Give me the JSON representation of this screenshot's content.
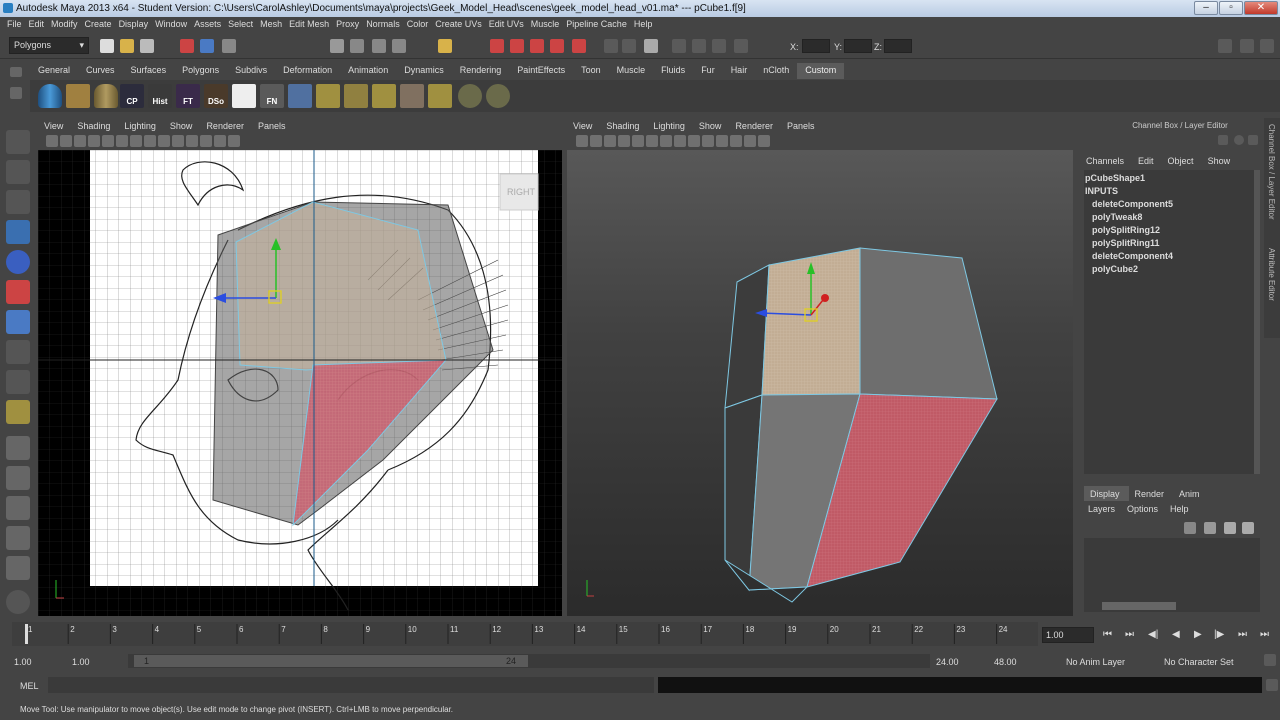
{
  "window": {
    "title": "Autodesk Maya 2013 x64 - Student Version: C:\\Users\\CarolAshley\\Documents\\maya\\projects\\Geek_Model_Head\\scenes\\geek_model_head_v01.ma*   ---   pCube1.f[9]"
  },
  "menu": [
    "File",
    "Edit",
    "Modify",
    "Create",
    "Display",
    "Window",
    "Assets",
    "Select",
    "Mesh",
    "Edit Mesh",
    "Proxy",
    "Normals",
    "Color",
    "Create UVs",
    "Edit UVs",
    "Muscle",
    "Pipeline Cache",
    "Help"
  ],
  "status": {
    "menuset": "Polygons",
    "x_label": "X:",
    "y_label": "Y:",
    "z_label": "Z:"
  },
  "shelf": {
    "tabs": [
      "General",
      "Curves",
      "Surfaces",
      "Polygons",
      "Subdivs",
      "Deformation",
      "Animation",
      "Dynamics",
      "Rendering",
      "PaintEffects",
      "Toon",
      "Muscle",
      "Fluids",
      "Fur",
      "Hair",
      "nCloth",
      "Custom"
    ],
    "active": "Custom",
    "buttons": [
      "",
      "",
      "",
      "CP",
      "Hist",
      "FT",
      "DSo",
      "Outl",
      "FN",
      "",
      "",
      "",
      "",
      "",
      "",
      "",
      ""
    ]
  },
  "viewport_menu": [
    "View",
    "Shading",
    "Lighting",
    "Show",
    "Renderer",
    "Panels"
  ],
  "left_view": {
    "label": "RIGHT"
  },
  "channel_box": {
    "header": "Channel Box / Layer Editor",
    "menu": [
      "Channels",
      "Edit",
      "Object",
      "Show"
    ],
    "node": "pCubeShape1",
    "inputs_label": "INPUTS",
    "inputs": [
      "deleteComponent5",
      "polyTweak8",
      "polySplitRing12",
      "polySplitRing11",
      "deleteComponent4",
      "polyCube2"
    ]
  },
  "layer_editor": {
    "tabs": [
      "Display",
      "Render",
      "Anim"
    ],
    "active": "Display",
    "menu": [
      "Layers",
      "Options",
      "Help"
    ]
  },
  "side_tabs": [
    "Channel Box / Layer Editor",
    "Attribute Editor"
  ],
  "timeline": {
    "ticks": [
      "1",
      "2",
      "3",
      "4",
      "5",
      "6",
      "7",
      "8",
      "9",
      "10",
      "11",
      "12",
      "13",
      "14",
      "15",
      "16",
      "17",
      "18",
      "19",
      "20",
      "21",
      "22",
      "23",
      "24"
    ],
    "current": "1.00"
  },
  "range": {
    "start": "1.00",
    "start2": "1.00",
    "slider_start": "1",
    "slider_end": "24",
    "end": "24.00",
    "end2": "48.00",
    "anim_layer": "No Anim Layer",
    "char_set": "No Character Set"
  },
  "cmd": {
    "label": "MEL"
  },
  "help": {
    "text": "Move Tool: Use manipulator to move object(s). Use edit mode to change pivot (INSERT).  Ctrl+LMB to move perpendicular."
  }
}
